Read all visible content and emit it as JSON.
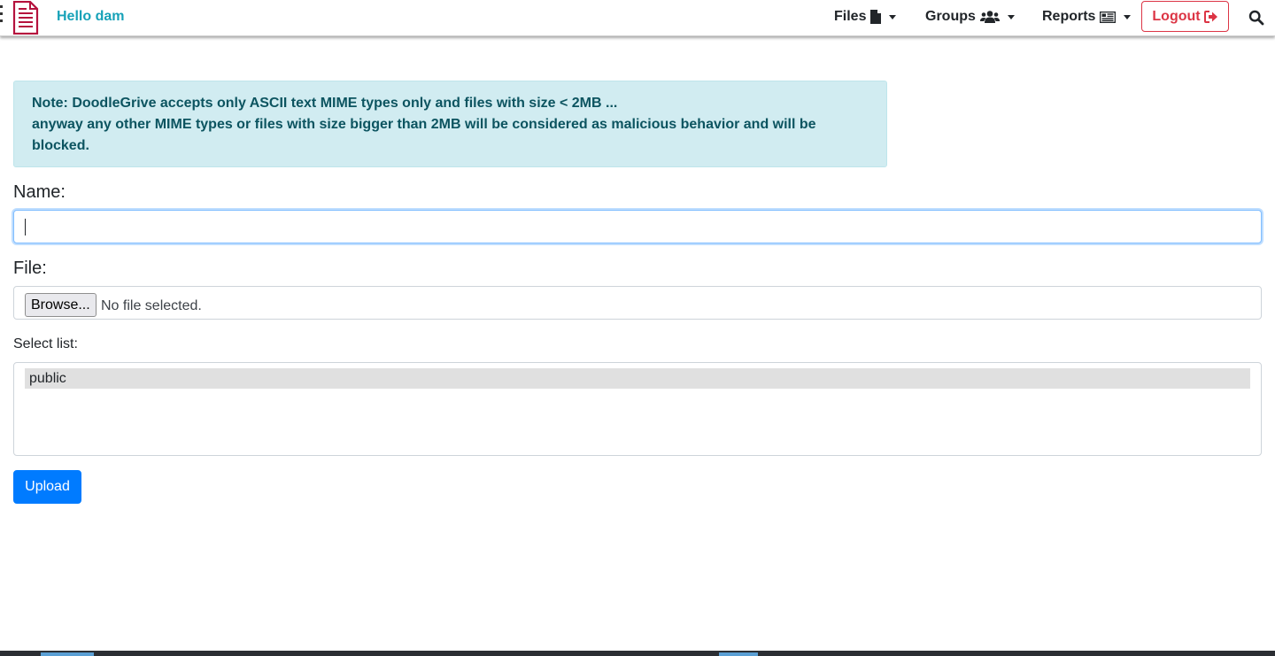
{
  "navbar": {
    "brand_icon": "document-icon",
    "greeting": "Hello dam",
    "items": [
      {
        "label": "Files",
        "icon": "file-icon"
      },
      {
        "label": "Groups",
        "icon": "users-icon"
      },
      {
        "label": "Reports",
        "icon": "newspaper-icon"
      }
    ],
    "logout_label": "Logout",
    "logout_icon": "sign-out-icon",
    "search_icon": "search-icon"
  },
  "alert": {
    "line1": "Note: DoodleGrive accepts only ASCII text MIME types only and files with size < 2MB ...",
    "line2": "anyway any other MIME types or files with size bigger than 2MB will be considered as malicious behavior and will be blocked."
  },
  "form": {
    "name_label": "Name:",
    "name_value": "",
    "file_label": "File:",
    "browse_label": "Browse...",
    "file_status": "No file selected.",
    "select_label": "Select list:",
    "select_options": [
      "public"
    ],
    "upload_label": "Upload"
  },
  "colors": {
    "brand": "#b5123d",
    "greeting": "#17a2b8",
    "logout": "#dc3545",
    "primary": "#007bff",
    "alert_bg": "#d1ecf1",
    "alert_text": "#0c5460"
  }
}
